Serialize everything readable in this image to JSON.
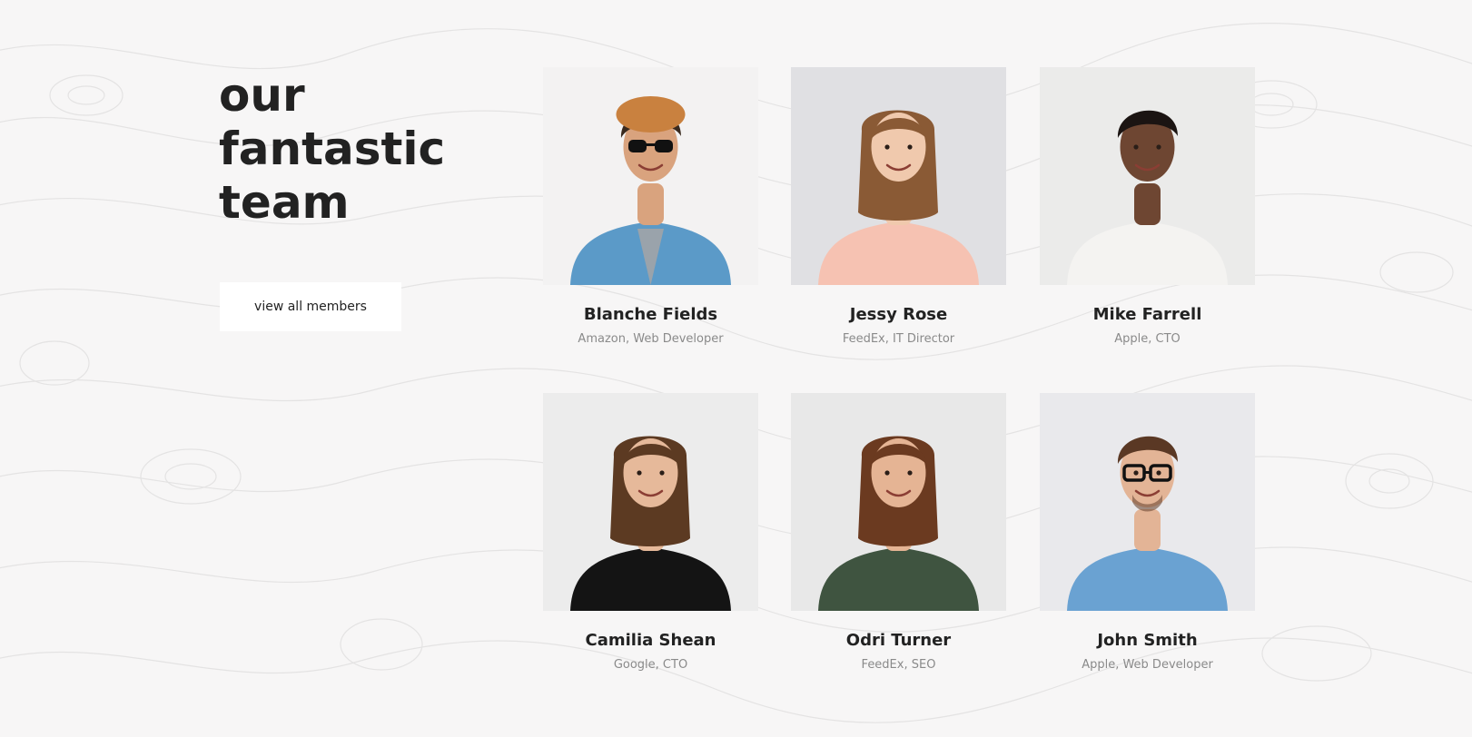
{
  "section": {
    "title_lines": [
      "our",
      "fantastic",
      "team"
    ],
    "view_all_label": "view all members"
  },
  "members": [
    {
      "name": "Blanche Fields",
      "role": "Amazon, Web Developer",
      "photo": {
        "bg": "#f3f2f2",
        "skin": "#d9a37e",
        "hair": "#3a2a1e",
        "top": "#5b9ac8",
        "accessory": "sunglasses-hat"
      }
    },
    {
      "name": "Jessy Rose",
      "role": "FeedEx, IT Director",
      "photo": {
        "bg": "#e0e0e3",
        "skin": "#f0c9ad",
        "hair": "#8a5a35",
        "top": "#f6c2b2",
        "accessory": "none"
      }
    },
    {
      "name": "Mike Farrell",
      "role": "Apple, CTO",
      "photo": {
        "bg": "#ebebea",
        "skin": "#6e4632",
        "hair": "#1b1412",
        "top": "#f4f3f1",
        "accessory": "none"
      }
    },
    {
      "name": "Camilia Shean",
      "role": "Google, CTO",
      "photo": {
        "bg": "#ececec",
        "skin": "#e6b99a",
        "hair": "#5c3a22",
        "top": "#141414",
        "accessory": "none"
      }
    },
    {
      "name": "Odri Turner",
      "role": "FeedEx, SEO",
      "photo": {
        "bg": "#e8e8e8",
        "skin": "#e5b494",
        "hair": "#6b3a20",
        "top": "#3f5440",
        "accessory": "none"
      }
    },
    {
      "name": "John Smith",
      "role": "Apple, Web Developer",
      "photo": {
        "bg": "#e9e9ec",
        "skin": "#e3b496",
        "hair": "#5a3824",
        "top": "#6aa2d2",
        "accessory": "glasses"
      }
    }
  ]
}
